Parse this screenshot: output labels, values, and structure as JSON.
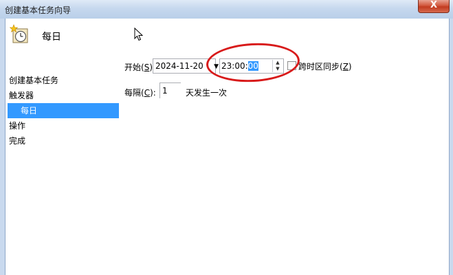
{
  "window": {
    "title": "创建基本任务向导",
    "close_label": "X"
  },
  "header": {
    "title": "每日"
  },
  "nav": {
    "items": [
      {
        "label": "创建基本任务"
      },
      {
        "label": "触发器"
      },
      {
        "label": "每日"
      },
      {
        "label": "操作"
      },
      {
        "label": "完成"
      }
    ]
  },
  "start": {
    "label_prefix": "开始(",
    "label_key": "S",
    "label_suffix": "):",
    "date_value": "2024-11-20",
    "time_prefix": "23:00:",
    "time_selected": "00"
  },
  "sync": {
    "label_prefix": "跨时区同步(",
    "label_key": "Z",
    "label_suffix": ")",
    "checked": false
  },
  "recur": {
    "label_prefix": "每隔(",
    "label_key": "C",
    "label_suffix": "):",
    "value": "1",
    "suffix": "天发生一次"
  },
  "colors": {
    "selection": "#3399ff",
    "annotation": "#d81a1a"
  }
}
